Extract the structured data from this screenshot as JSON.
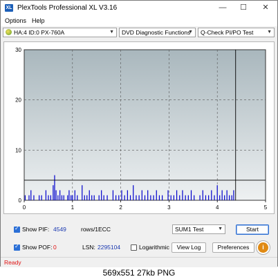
{
  "window": {
    "title": "PlexTools Professional XL V3.16",
    "icon_text": "XL",
    "minimize_glyph": "—",
    "maximize_glyph": "☐",
    "close_glyph": "✕"
  },
  "menu": {
    "options": "Options",
    "help": "Help"
  },
  "toolbar": {
    "drive": "HA:4 ID:0  PX-760A",
    "function": "DVD Diagnostic Functions",
    "test": "Q-Check PI/PO Test"
  },
  "chart_data": {
    "type": "bar",
    "title": "",
    "xlabel": "",
    "ylabel": "",
    "xlim": [
      0,
      5
    ],
    "ylim": [
      0,
      30
    ],
    "x_ticks": [
      0,
      1,
      2,
      3,
      4,
      5
    ],
    "y_ticks": [
      0,
      10,
      20,
      30
    ],
    "y_tick_labels_shown": [
      "0",
      "10",
      "20",
      "30"
    ],
    "threshold": 4,
    "end_marker_x": 4.38,
    "grid": true,
    "series": [
      {
        "color": "#0000cc",
        "x": [
          0.02,
          0.06,
          0.1,
          0.14,
          0.2,
          0.26,
          0.31,
          0.36,
          0.4,
          0.45,
          0.5,
          0.55,
          0.6,
          0.63,
          0.66,
          0.7,
          0.74,
          0.78,
          0.82,
          0.86,
          0.9,
          0.93,
          0.97,
          1.0,
          1.05,
          1.1,
          1.15,
          1.2,
          1.25,
          1.3,
          1.35,
          1.4,
          1.45,
          1.5,
          1.55,
          1.6,
          1.65,
          1.72,
          1.78,
          1.84,
          1.9,
          1.96,
          2.02,
          2.08,
          2.14,
          2.2,
          2.26,
          2.32,
          2.38,
          2.44,
          2.5,
          2.56,
          2.62,
          2.68,
          2.74,
          2.8,
          2.86,
          2.92,
          2.98,
          3.04,
          3.1,
          3.16,
          3.22,
          3.28,
          3.34,
          3.4,
          3.46,
          3.52,
          3.58,
          3.64,
          3.7,
          3.76,
          3.82,
          3.88,
          3.94,
          4.0,
          4.05,
          4.1,
          4.15,
          4.2,
          4.25,
          4.3,
          4.34
        ],
        "values": [
          1,
          0,
          1,
          2,
          1,
          0,
          1,
          1,
          0,
          2,
          1,
          1,
          3,
          5,
          2,
          1,
          2,
          1,
          1,
          0,
          1,
          2,
          1,
          1,
          2,
          1,
          0,
          3,
          1,
          1,
          2,
          1,
          1,
          0,
          1,
          2,
          1,
          1,
          0,
          2,
          1,
          1,
          2,
          1,
          2,
          1,
          3,
          1,
          1,
          2,
          1,
          2,
          1,
          1,
          2,
          1,
          1,
          0,
          2,
          1,
          1,
          2,
          1,
          2,
          1,
          1,
          2,
          1,
          0,
          1,
          2,
          1,
          1,
          2,
          1,
          3,
          1,
          2,
          1,
          2,
          1,
          1,
          2
        ]
      }
    ]
  },
  "controls": {
    "show_pif_label": "Show PIF:",
    "pif_value": "4549",
    "rows_label": "rows/1ECC",
    "show_pof_label": "Show POF:",
    "pof_value": "0",
    "lsn_label": "LSN:",
    "lsn_value": "2295104",
    "logarithmic_label": "Logarithmic",
    "sum_test": "SUM1 Test",
    "start_label": "Start",
    "view_log_label": "View Log",
    "preferences_label": "Preferences",
    "info_glyph": "i"
  },
  "status": {
    "text": "Ready"
  },
  "caption": {
    "text": "569x551  27kb  PNG"
  }
}
